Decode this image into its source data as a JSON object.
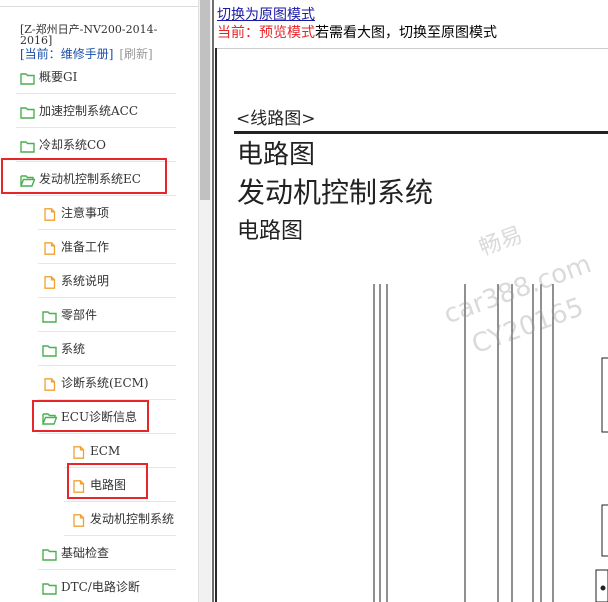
{
  "tree": {
    "doc_title": "[Z-郑州日产-NV200-2014-2016]",
    "current_prefix": "[当前：",
    "current_value": "维修手册]",
    "refresh": "[刷新]",
    "items": [
      {
        "label": "概要GI",
        "icon": "folder-icon"
      },
      {
        "label": "加速控制系统ACC",
        "icon": "folder-icon"
      },
      {
        "label": "冷却系统CO",
        "icon": "folder-icon"
      },
      {
        "label": "发动机控制系统EC",
        "icon": "folder-open-icon"
      },
      {
        "label": "注意事项",
        "icon": "document-icon"
      },
      {
        "label": "准备工作",
        "icon": "document-icon"
      },
      {
        "label": "系统说明",
        "icon": "document-icon"
      },
      {
        "label": "零部件",
        "icon": "folder-icon"
      },
      {
        "label": "系统",
        "icon": "folder-icon"
      },
      {
        "label": "诊断系统(ECM)",
        "icon": "document-icon"
      },
      {
        "label": "ECU诊断信息",
        "icon": "folder-open-icon"
      },
      {
        "label": "ECM",
        "icon": "document-icon"
      },
      {
        "label": "电路图",
        "icon": "document-icon"
      },
      {
        "label": "发动机控制系统",
        "icon": "document-icon"
      },
      {
        "label": "基础检查",
        "icon": "folder-icon"
      },
      {
        "label": "DTC/电路诊断",
        "icon": "folder-icon"
      }
    ]
  },
  "viewer": {
    "switch_link": "切换为原图模式",
    "mode_prefix": "当前：预览模式",
    "mode_suffix": "若需看大图，切换至原图模式",
    "section_tag": "<线路图>",
    "title1": "电路图",
    "title2": "发动机控制系统",
    "title3": "电路图",
    "watermark": [
      "畅易",
      "car388.com",
      "CY20165"
    ]
  },
  "colors": {
    "highlight": "#e8262a",
    "link": "#1a1aa6",
    "folder": "#4caf50",
    "document": "#f0a030"
  }
}
